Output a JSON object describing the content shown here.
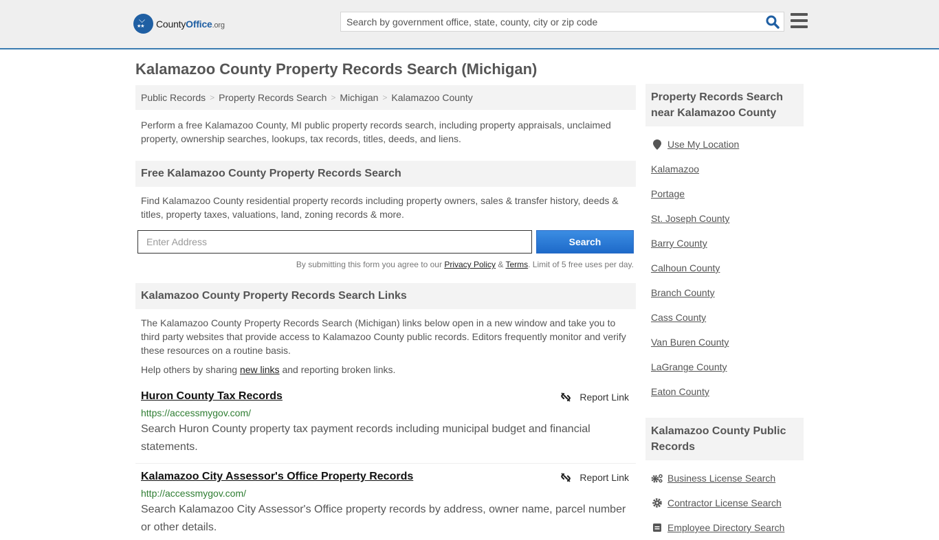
{
  "header": {
    "logo": {
      "prefix": "County",
      "brand": "Office",
      "suffix": ".org"
    },
    "search_placeholder": "Search by government office, state, county, city or zip code"
  },
  "page_title": "Kalamazoo County Property Records Search (Michigan)",
  "breadcrumb": [
    "Public Records",
    "Property Records Search",
    "Michigan",
    "Kalamazoo County"
  ],
  "breadcrumb_sep": ">",
  "intro": "Perform a free Kalamazoo County, MI public property records search, including property appraisals, unclaimed property, ownership searches, lookups, tax records, titles, deeds, and liens.",
  "free_search": {
    "heading": "Free Kalamazoo County Property Records Search",
    "description": "Find Kalamazoo County residential property records including property owners, sales & transfer history, deeds & titles, property taxes, valuations, land, zoning records & more.",
    "address_placeholder": "Enter Address",
    "button": "Search",
    "disclaimer_pre": "By submitting this form you agree to our ",
    "privacy": "Privacy Policy",
    "amp": " & ",
    "terms": "Terms",
    "disclaimer_post": ". Limit of 5 free uses per day."
  },
  "links_section": {
    "heading": "Kalamazoo County Property Records Search Links",
    "description": "The Kalamazoo County Property Records Search (Michigan) links below open in a new window and take you to third party websites that provide access to Kalamazoo County public records. Editors frequently monitor and verify these resources on a routine basis.",
    "help_pre": "Help others by sharing ",
    "help_link": "new links",
    "help_post": " and reporting broken links.",
    "report_label": "Report Link",
    "items": [
      {
        "title": "Huron County Tax Records",
        "url": "https://accessmygov.com/",
        "desc": "Search Huron County property tax payment records including municipal budget and financial statements."
      },
      {
        "title": "Kalamazoo City Assessor's Office Property Records",
        "url": "http://accessmygov.com/",
        "desc": "Search Kalamazoo City Assessor's Office property records by address, owner name, parcel number or other details."
      }
    ]
  },
  "sidebar": {
    "nearby_heading": "Property Records Search near Kalamazoo County",
    "use_location": "Use My Location",
    "nearby": [
      "Kalamazoo",
      "Portage",
      "St. Joseph County",
      "Barry County",
      "Calhoun County",
      "Branch County",
      "Cass County",
      "Van Buren County",
      "LaGrange County",
      "Eaton County"
    ],
    "public_heading": "Kalamazoo County Public Records",
    "public_records": [
      {
        "label": "Business License Search",
        "icon": "gears-icon"
      },
      {
        "label": "Contractor License Search",
        "icon": "gear-icon"
      },
      {
        "label": "Employee Directory Search",
        "icon": "id-card-icon"
      }
    ]
  }
}
